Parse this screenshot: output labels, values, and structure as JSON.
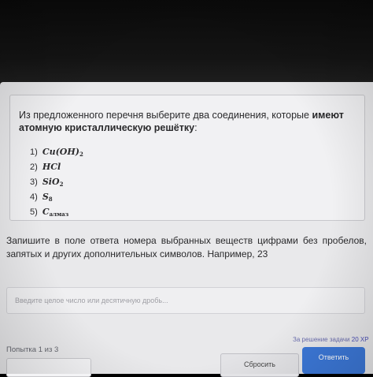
{
  "question": {
    "text_before": "Из предложенного перечня выберите два соединения, которые",
    "text_bold": "имеют атомную кристаллическую решётку",
    "text_after": ":",
    "options": [
      {
        "num": "1)",
        "formula": "Cu(OH)",
        "sub": "2"
      },
      {
        "num": "2)",
        "formula": "HCl",
        "sub": ""
      },
      {
        "num": "3)",
        "formula": "SiO",
        "sub": "2"
      },
      {
        "num": "4)",
        "formula": "S",
        "sub": "8"
      },
      {
        "num": "5)",
        "formula": "C",
        "sub": "алмаз"
      }
    ]
  },
  "instruction": "Запишите в поле ответа номера выбранных веществ цифрами без пробелов, запятых и других дополнительных символов. Например, 23",
  "answer": {
    "placeholder": "Введите целое число или десятичную дробь...",
    "value": ""
  },
  "reward": {
    "label": "За решение задачи",
    "xp": "20 XP"
  },
  "attempt": "Попытка 1 из 3",
  "buttons": {
    "skip": "Сбросить",
    "submit": "Ответить"
  },
  "colors": {
    "accent": "#3c78d8",
    "screen_bg": "#e9e9eb",
    "card_bg": "#f1f1f3"
  }
}
